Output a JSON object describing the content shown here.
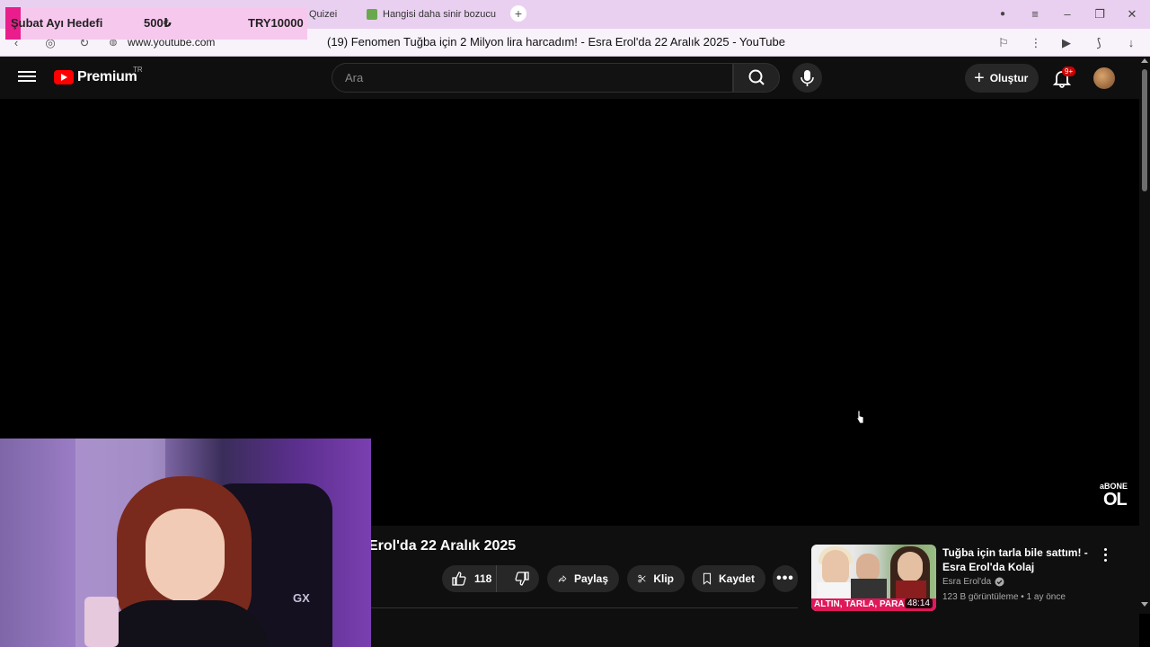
{
  "browser": {
    "tabs": [
      {
        "label": "Quizei"
      },
      {
        "label": "Hangisi daha sinir bozucu"
      }
    ],
    "new_tab_label": "+",
    "url": "www.youtube.com",
    "page_title": "(19) Fenomen Tuğba için 2 Milyon lira harcadım! - Esra Erol'da 22 Aralık 2025 - YouTube"
  },
  "donation_goal": {
    "label": "Şubat Ayı Hedefi",
    "current": "500₺",
    "target": "TRY10000",
    "progress_fraction": 0.05,
    "bar_color": "#e91e8c"
  },
  "youtube": {
    "brand": "Premium",
    "region": "TR",
    "search_placeholder": "Ara",
    "create_label": "Oluştur",
    "notification_badge": "9+",
    "accent": "#ff0000"
  },
  "player": {
    "overlay_abone": "aBONE",
    "overlay_ol": "OL"
  },
  "video": {
    "title_visible": "Erol'da 22 Aralık 2025",
    "like_count": "118",
    "share_label": "Paylaş",
    "clip_label": "Klip",
    "save_label": "Kaydet"
  },
  "recommended": [
    {
      "title": "Tuğba için tarla bile sattım! - Esra Erol'da Kolaj",
      "channel": "Esra Erol'da",
      "meta": "123 B görüntüleme • 1 ay önce",
      "duration": "48:14",
      "thumb_text": "ALTIN, TARLA, PARA"
    }
  ],
  "webcam": {
    "chair_logo": "GX"
  }
}
